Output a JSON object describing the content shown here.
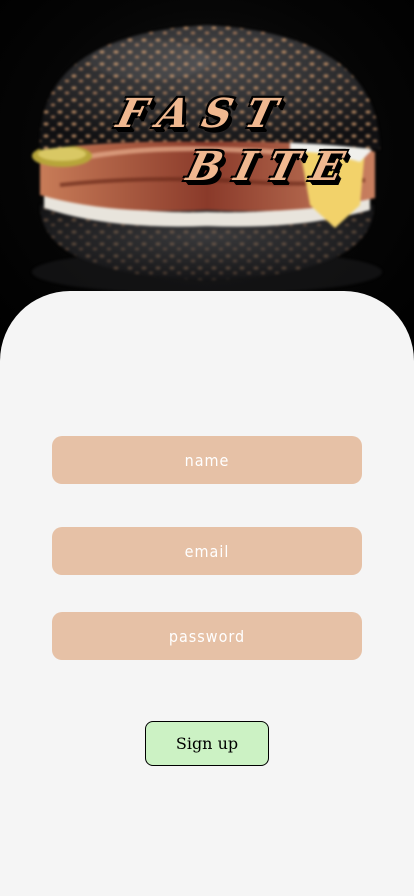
{
  "app": {
    "title_line_1": "Fast",
    "title_line_2": "Bite"
  },
  "hero": {
    "image_subject": "black sesame burger"
  },
  "form": {
    "name_placeholder": "name",
    "email_placeholder": "email",
    "password_placeholder": "password",
    "signup_label": "Sign up"
  },
  "colors": {
    "field_background": "#e6c1a6",
    "card_background": "#f5f5f5",
    "button_background": "#ccf2c4",
    "logo_text": "#f0b890"
  }
}
